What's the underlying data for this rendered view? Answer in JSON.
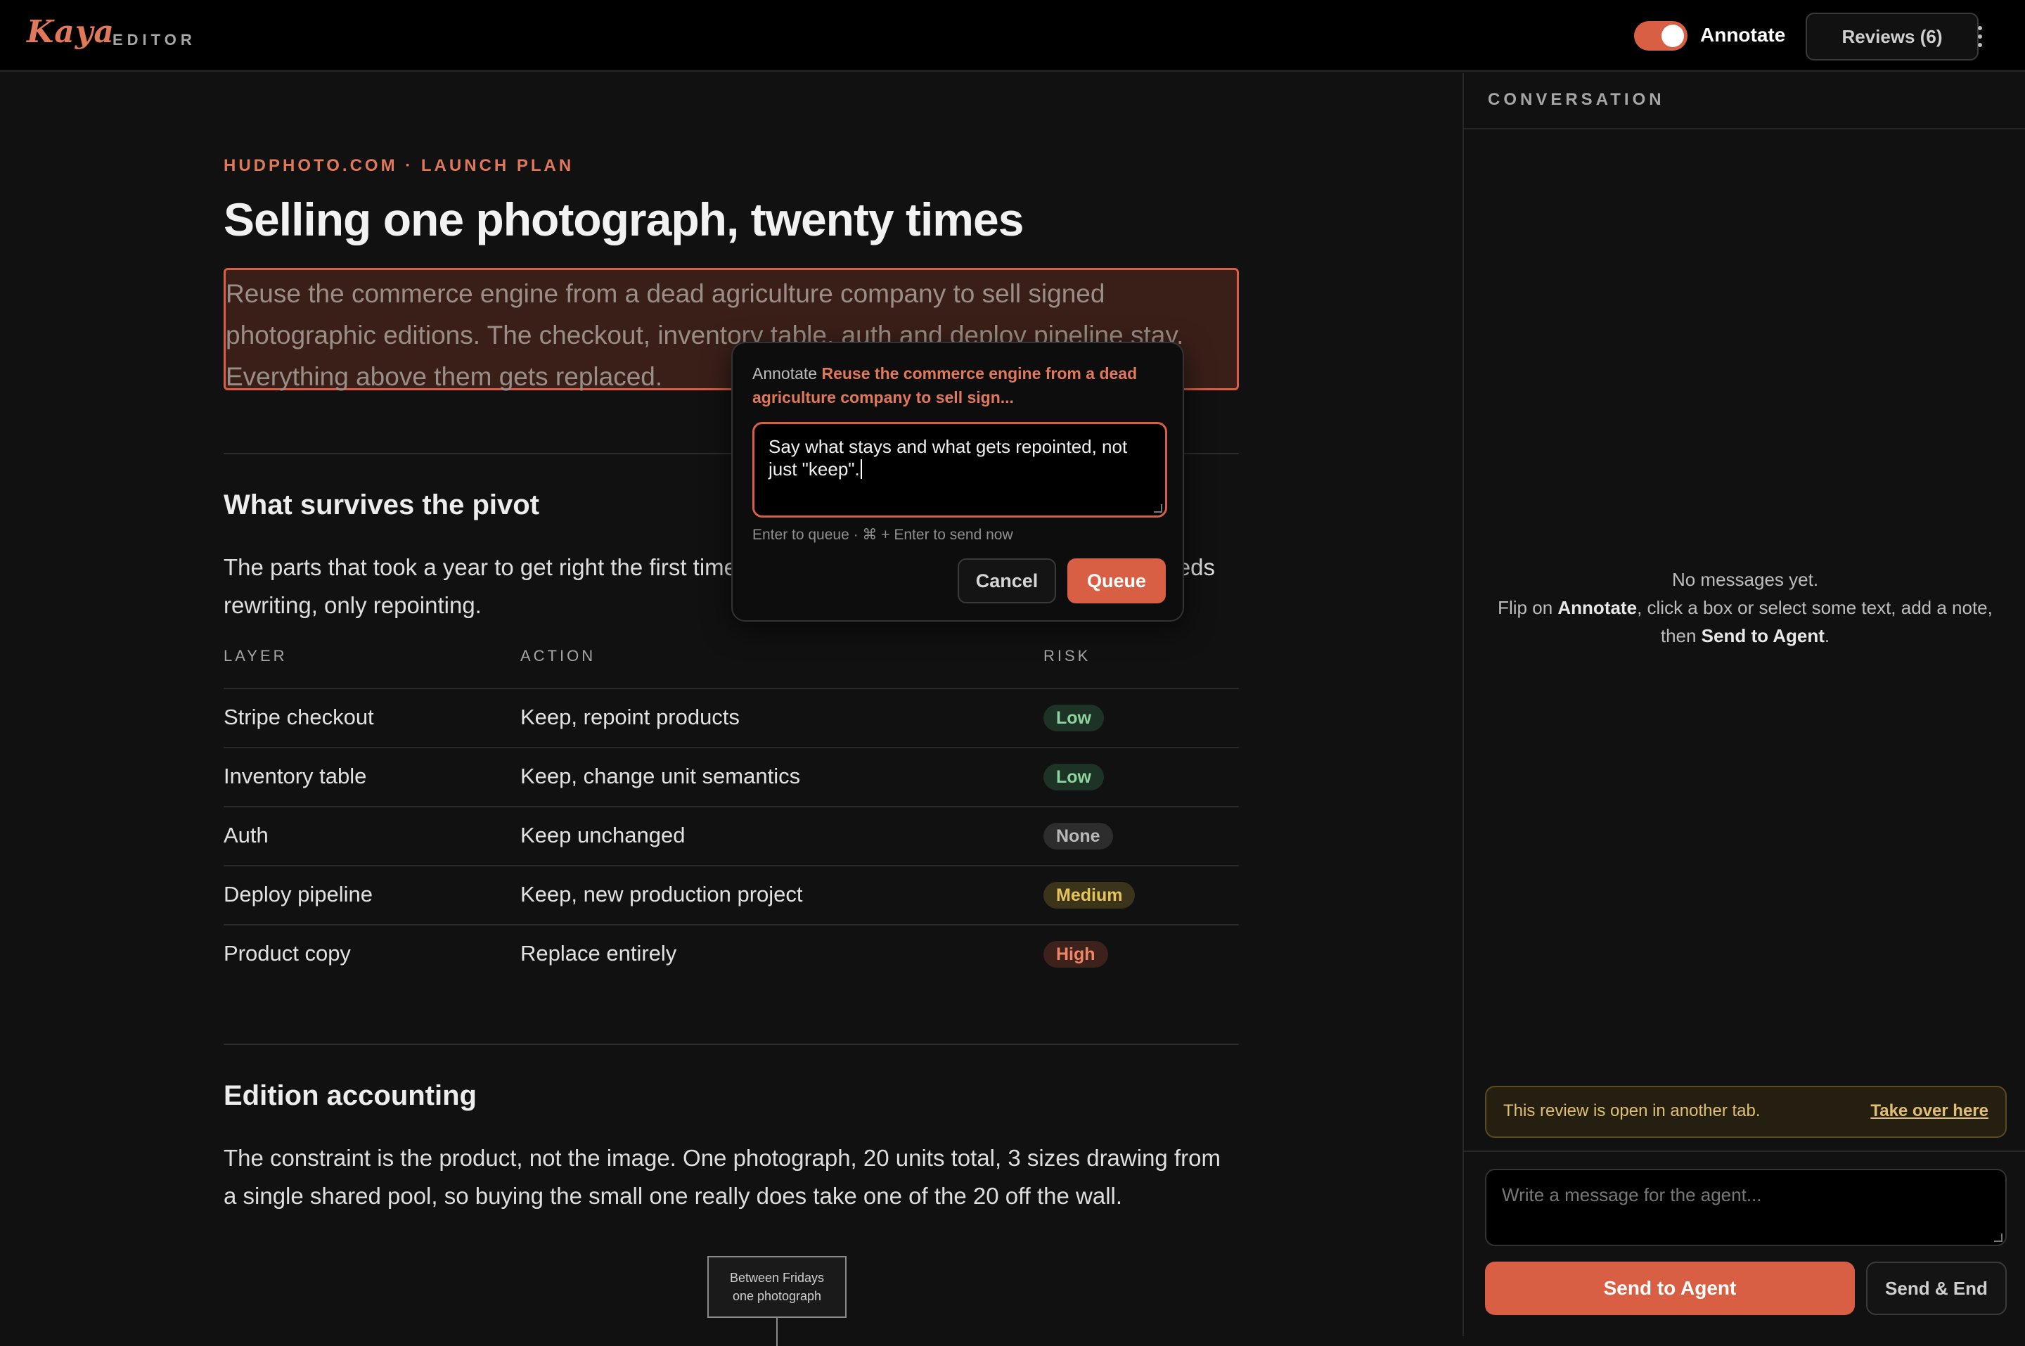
{
  "app": {
    "logo": "Kaya",
    "logo_sub": "EDITOR",
    "annotate_label": "Annotate",
    "annotate_on": true,
    "reviews_label": "Reviews (6)"
  },
  "doc": {
    "kicker": "HUDPHOTO.COM · LAUNCH PLAN",
    "title": "Selling one photograph, twenty times",
    "lede": "Reuse the commerce engine from a dead agriculture company to sell signed photographic editions. The checkout, inventory table, auth and deploy pipeline stay. Everything above them gets replaced.",
    "section1": {
      "heading": "What survives the pivot",
      "para": "The parts that took a year to get right the first time are the parts that stay. None of this line needs rewriting, only repointing."
    },
    "table": {
      "headers": [
        "LAYER",
        "ACTION",
        "RISK"
      ],
      "rows": [
        {
          "layer": "Stripe checkout",
          "action": "Keep, repoint products",
          "risk": "Low"
        },
        {
          "layer": "Inventory table",
          "action": "Keep, change unit semantics",
          "risk": "Low"
        },
        {
          "layer": "Auth",
          "action": "Keep unchanged",
          "risk": "None"
        },
        {
          "layer": "Deploy pipeline",
          "action": "Keep, new production project",
          "risk": "Medium"
        },
        {
          "layer": "Product copy",
          "action": "Replace entirely",
          "risk": "High"
        }
      ]
    },
    "section2": {
      "heading": "Edition accounting",
      "para": "The constraint is the product, not the image. One photograph, 20 units total, 3 sizes drawing from a single shared pool, so buying the small one really does take one of the 20 off the wall."
    },
    "diagram": {
      "line1": "Between Fridays",
      "line2": "one photograph"
    }
  },
  "popover": {
    "prefix": "Annotate",
    "quote": "Reuse the commerce engine from a dead agriculture company to sell sign...",
    "input_value": "Say what stays and what gets repointed, not just \"keep\".",
    "hint": "Enter to queue · ⌘ + Enter to send now",
    "cancel": "Cancel",
    "queue": "Queue"
  },
  "panel": {
    "title": "CONVERSATION",
    "empty_line1": "No messages yet.",
    "empty_pre": "Flip on ",
    "empty_b1": "Annotate",
    "empty_mid": ", click a box or select some text, add a note, then ",
    "empty_b2": "Send to Agent",
    "empty_end": ".",
    "warning": "This review is open in another tab.",
    "take_over": "Take over here",
    "message_placeholder": "Write a message for the agent...",
    "send": "Send to Agent",
    "send_end": "Send & End"
  },
  "icons": {
    "menu": "kebab-menu-icon",
    "resize": "resize-handle-icon"
  },
  "colors": {
    "accent": "#d95f44",
    "risk_low": "#8fd3a0",
    "risk_none": "#b8b8b8",
    "risk_medium": "#e6c35a",
    "risk_high": "#ef8566"
  }
}
